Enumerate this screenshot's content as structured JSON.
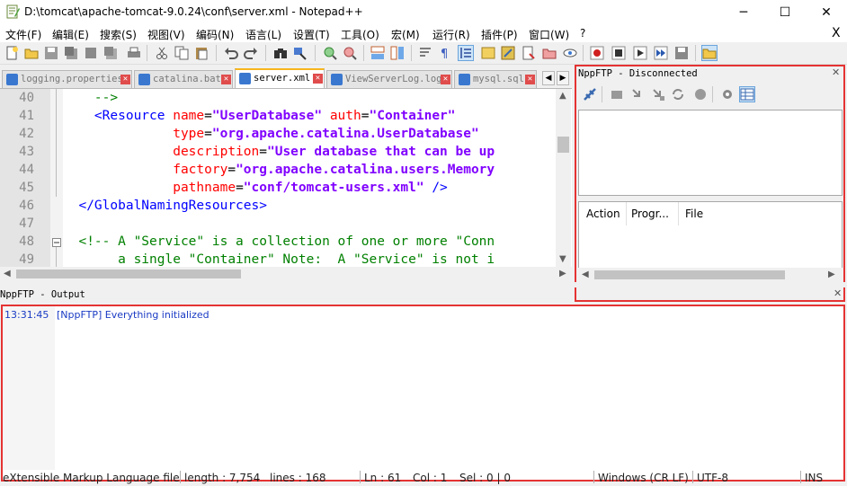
{
  "window": {
    "title": "D:\\tomcat\\apache-tomcat-9.0.24\\conf\\server.xml - Notepad++",
    "min_glyph": "─",
    "max_glyph": "☐",
    "close_glyph": "✕"
  },
  "menu": {
    "items": [
      "文件(F)",
      "编辑(E)",
      "搜索(S)",
      "视图(V)",
      "编码(N)",
      "语言(L)",
      "设置(T)",
      "工具(O)",
      "宏(M)",
      "运行(R)",
      "插件(P)",
      "窗口(W)",
      "?"
    ],
    "close_glyph": "X"
  },
  "toolbar": {
    "icons": [
      "new-file-icon",
      "open-file-icon",
      "save-icon",
      "save-all-icon",
      "close-icon",
      "close-all-icon",
      "print-icon",
      "cut-icon",
      "copy-icon",
      "paste-icon",
      "undo-icon",
      "redo-icon",
      "find-icon",
      "replace-icon",
      "zoom-in-icon",
      "zoom-out-icon",
      "sync-v-icon",
      "sync-h-icon",
      "word-wrap-icon",
      "show-all-chars-icon",
      "indent-guide-icon",
      "doc-map-icon",
      "function-list-icon",
      "folder-workspace-icon",
      "monitor-icon",
      "record-macro-icon",
      "stop-macro-icon",
      "play-macro-icon",
      "run-macro-multiple-icon",
      "save-macro-icon",
      "nppftp-icon"
    ]
  },
  "tabs": [
    {
      "label": "logging.properties",
      "active": false
    },
    {
      "label": "catalina.bat",
      "active": false
    },
    {
      "label": "server.xml",
      "active": true
    },
    {
      "label": "ViewServerLog.log",
      "active": false
    },
    {
      "label": "mysql.sql",
      "active": false
    }
  ],
  "editor": {
    "lines": [
      {
        "num": "40",
        "segments": [
          {
            "t": "    -->",
            "c": "c-cmt"
          }
        ]
      },
      {
        "num": "41",
        "segments": [
          {
            "t": "    <Resource ",
            "c": "c-tag"
          },
          {
            "t": "name",
            "c": "c-attr"
          },
          {
            "t": "=",
            "c": "c-txt"
          },
          {
            "t": "\"UserDatabase\"",
            "c": "c-str"
          },
          {
            "t": " auth",
            "c": "c-attr"
          },
          {
            "t": "=",
            "c": "c-txt"
          },
          {
            "t": "\"Container\"",
            "c": "c-str"
          }
        ]
      },
      {
        "num": "42",
        "segments": [
          {
            "t": "              type",
            "c": "c-attr"
          },
          {
            "t": "=",
            "c": "c-txt"
          },
          {
            "t": "\"org.apache.catalina.UserDatabase\"",
            "c": "c-str"
          }
        ]
      },
      {
        "num": "43",
        "segments": [
          {
            "t": "              description",
            "c": "c-attr"
          },
          {
            "t": "=",
            "c": "c-txt"
          },
          {
            "t": "\"User database that can be up",
            "c": "c-str"
          }
        ]
      },
      {
        "num": "44",
        "segments": [
          {
            "t": "              factory",
            "c": "c-attr"
          },
          {
            "t": "=",
            "c": "c-txt"
          },
          {
            "t": "\"org.apache.catalina.users.Memory",
            "c": "c-str"
          }
        ]
      },
      {
        "num": "45",
        "segments": [
          {
            "t": "              pathname",
            "c": "c-attr"
          },
          {
            "t": "=",
            "c": "c-txt"
          },
          {
            "t": "\"conf/tomcat-users.xml\"",
            "c": "c-str"
          },
          {
            "t": " />",
            "c": "c-tag"
          }
        ]
      },
      {
        "num": "46",
        "segments": [
          {
            "t": "  </GlobalNamingResources>",
            "c": "c-tag"
          }
        ]
      },
      {
        "num": "47",
        "segments": [
          {
            "t": "",
            "c": "c-txt"
          }
        ]
      },
      {
        "num": "48",
        "segments": [
          {
            "t": "  <!-- A \"Service\" is a collection of one or more \"Conn",
            "c": "c-cmt"
          }
        ]
      },
      {
        "num": "49",
        "segments": [
          {
            "t": "       a single \"Container\" Note:  A \"Service\" is not i",
            "c": "c-cmt"
          }
        ]
      }
    ]
  },
  "ftp": {
    "title": "NppFTP - Disconnected",
    "close_glyph": "✕",
    "icons": [
      "connect-icon",
      "download-icon",
      "upload-icon",
      "upload-current-icon",
      "refresh-icon",
      "abort-icon",
      "settings-icon",
      "show-messages-icon"
    ],
    "queue_headers": [
      "Action",
      "Progr...",
      "File"
    ]
  },
  "output": {
    "title": "NppFTP - Output",
    "close_glyph": "✕",
    "time": "13:31:45",
    "message": "[NppFTP] Everything initialized"
  },
  "status": {
    "lang": "eXtensible Markup Language file",
    "length": "length : 7,754",
    "lines": "lines : 168",
    "ln": "Ln : 61",
    "col": "Col : 1",
    "sel": "Sel : 0 | 0",
    "eol": "Windows (CR LF)",
    "enc": "UTF-8",
    "ins": "INS"
  },
  "colors": {
    "highlight_border": "#e53333",
    "tag": "#0000ff",
    "attr": "#ff0000",
    "string": "#8000ff",
    "comment": "#008000",
    "output_text": "#1a3bc4"
  }
}
